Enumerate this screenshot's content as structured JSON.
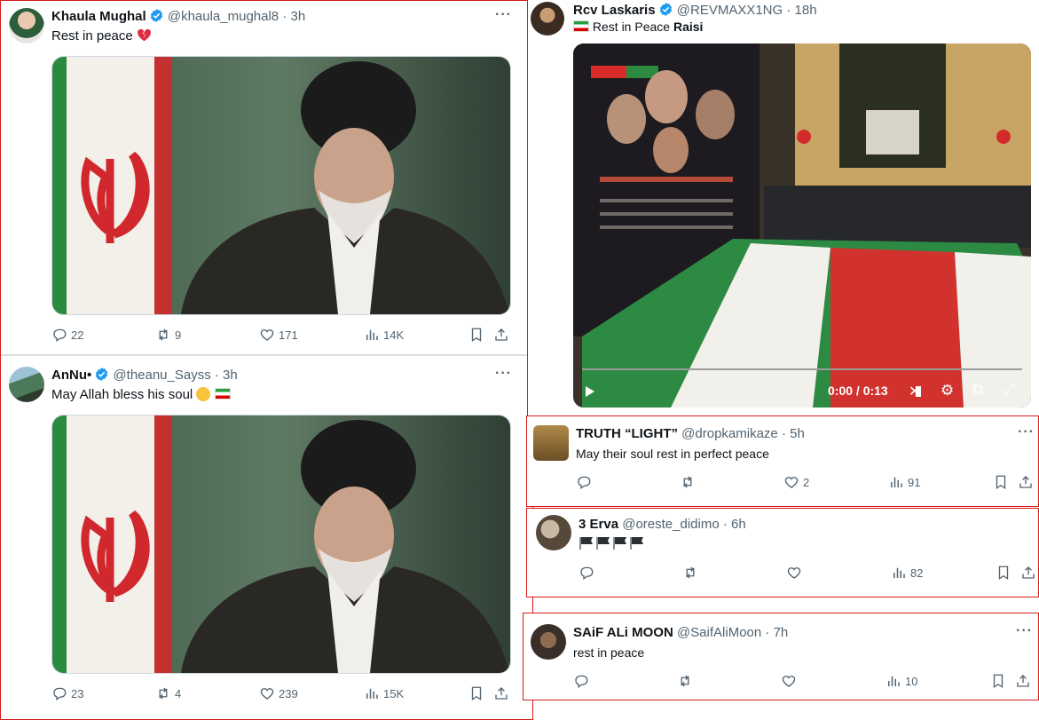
{
  "left_tweets": [
    {
      "name": "Khaula Mughal",
      "handle": "@khaula_mughal8",
      "time": "· 3h",
      "text": "Rest in peace",
      "replies": "22",
      "reposts": "9",
      "likes": "171",
      "views": "14K"
    },
    {
      "name": "AnNu•",
      "handle": "@theanu_Sayss",
      "time": "· 3h",
      "text": "May Allah bless his soul",
      "replies": "23",
      "reposts": "4",
      "likes": "239",
      "views": "15K"
    }
  ],
  "top_right": {
    "name": "Rcv Laskaris",
    "handle": "@REVMAXX1NG",
    "time": "· 18h",
    "text": "Rest in Peace",
    "text_bold": "Raisi",
    "video_time": "0:00 / 0:13"
  },
  "replies": [
    {
      "name": "TRUTH “LIGHT”",
      "handle": "@dropkamikaze",
      "time": "· 5h",
      "text": "May their soul rest in perfect peace",
      "likes": "2",
      "views": "91"
    },
    {
      "name": "3 Erva",
      "handle": "@oreste_didimo",
      "time": "· 6h",
      "text": "",
      "views": "82"
    },
    {
      "name": "SAiF ALi MOON",
      "handle": "@SaifAliMoon",
      "time": "· 7h",
      "text": "rest in peace",
      "views": "10"
    }
  ],
  "more_label": "···",
  "colors": {
    "verified": "#1d9bf0",
    "muted": "#536471",
    "frame": "#d71a1a"
  }
}
